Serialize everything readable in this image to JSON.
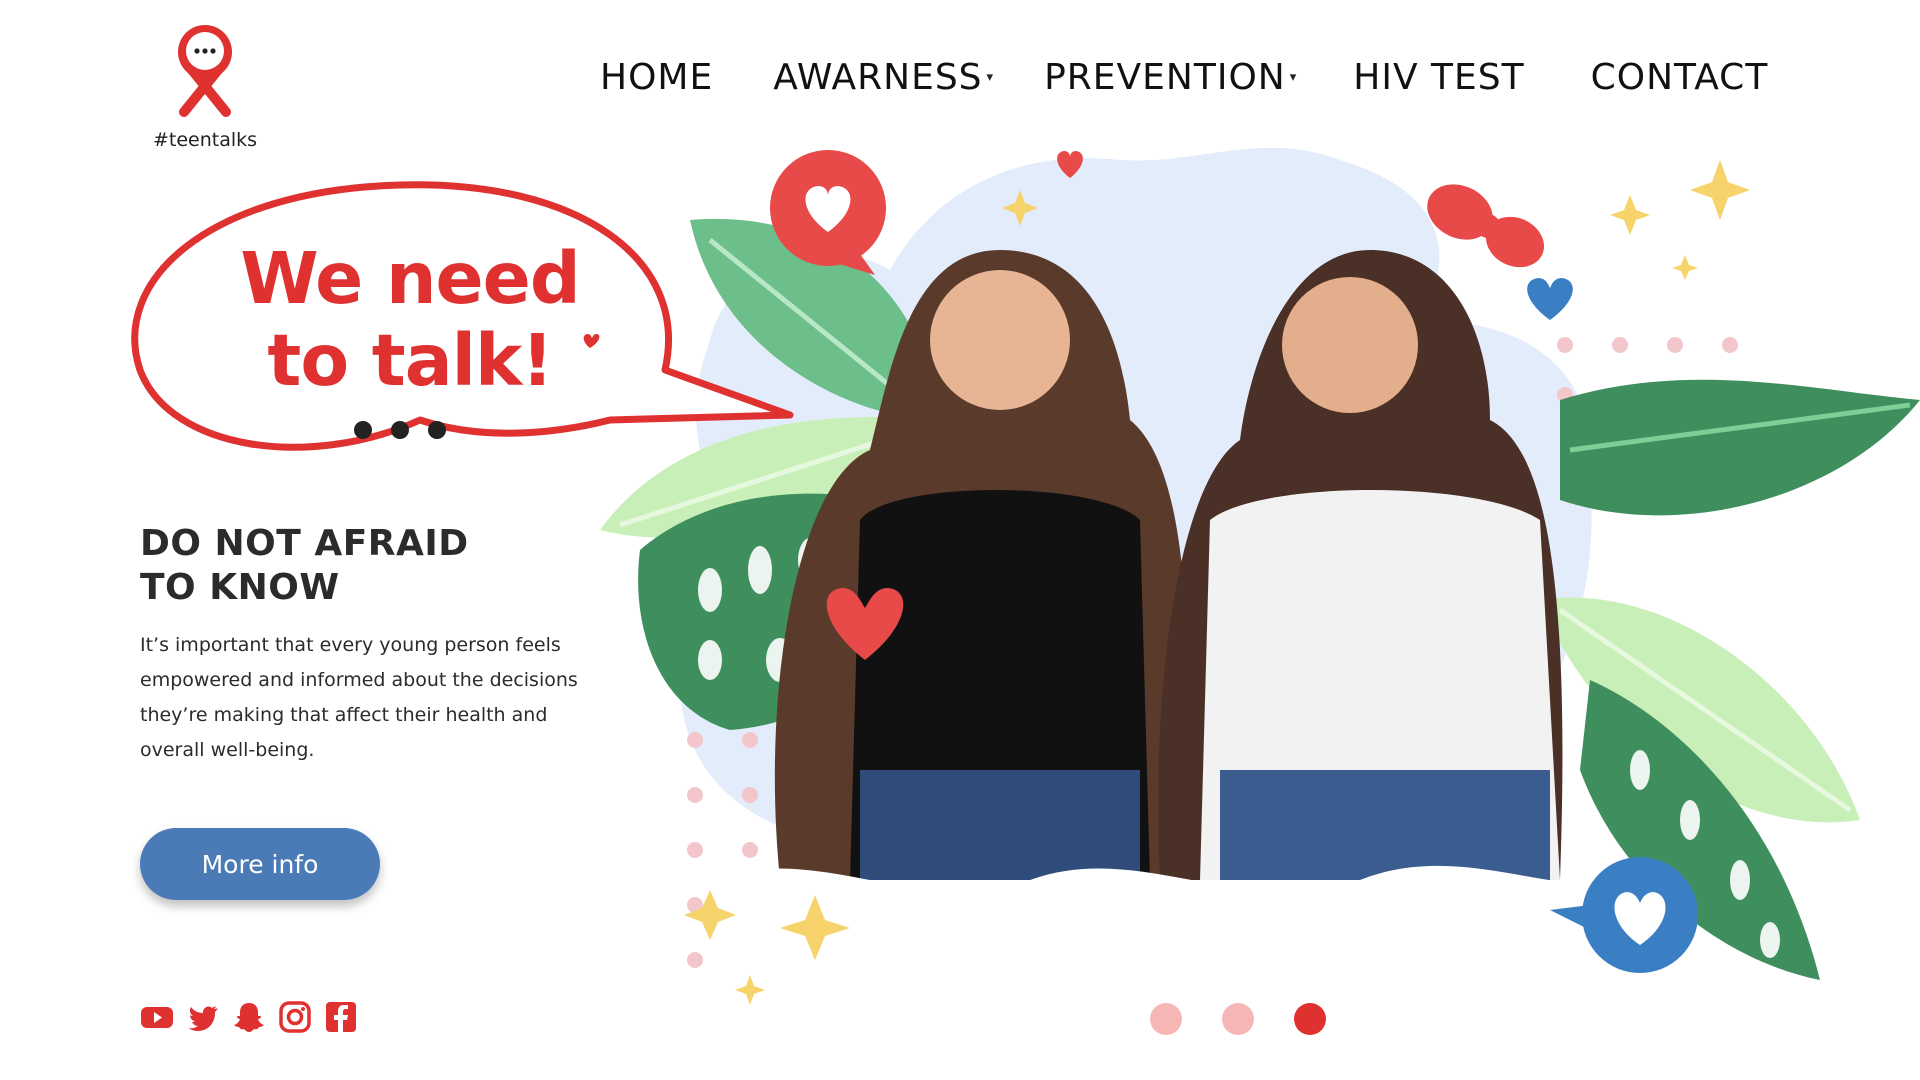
{
  "brand": {
    "tagline": "#teentalks",
    "logo_icon": "ribbon-chat-icon",
    "accent": "#e03131"
  },
  "nav": {
    "items": [
      {
        "label": "HOME",
        "has_dropdown": false
      },
      {
        "label": "AWARNESS",
        "has_dropdown": true
      },
      {
        "label": "PREVENTION",
        "has_dropdown": true
      },
      {
        "label": "HIV TEST",
        "has_dropdown": false
      },
      {
        "label": "CONTACT",
        "has_dropdown": false
      }
    ],
    "caret": "▾"
  },
  "hero": {
    "headline_line1": "We need",
    "headline_line2": "to talk!",
    "subhead_line1": "DO NOT AFRAID",
    "subhead_line2": "TO KNOW",
    "body": "It’s important that every young person feels empowered and informed about the decisions they’re making that affect their health and overall well-being.",
    "button_label": "More info",
    "button_color": "#4a7bb7"
  },
  "social": [
    "youtube-icon",
    "twitter-icon",
    "snapchat-icon",
    "instagram-icon",
    "facebook-icon"
  ],
  "carousel": {
    "slides": 3,
    "active_index": 3
  },
  "colors": {
    "leaf_dark": "#3f8f5e",
    "leaf_light": "#c9efb8",
    "blob": "#e3ecfb",
    "heart_red": "#e84a4a",
    "heart_blue": "#3a7fc4",
    "star": "#f7d36b"
  }
}
